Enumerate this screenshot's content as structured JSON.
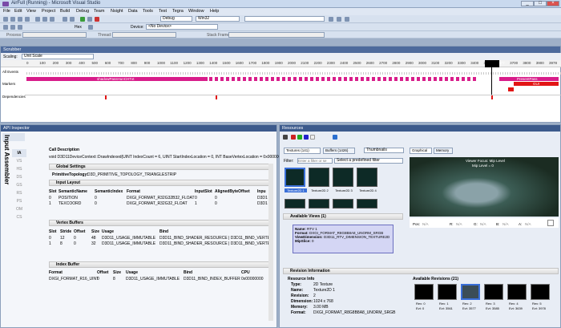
{
  "window": {
    "title": "AirFull (Running) - Microsoft Visual Studio"
  },
  "menu": [
    "File",
    "Edit",
    "View",
    "Project",
    "Build",
    "Debug",
    "Team",
    "Nsight",
    "Data",
    "Tools",
    "Test",
    "Tegra",
    "Window",
    "Help"
  ],
  "toolbar": {
    "config": "Debug",
    "platform": "Win32",
    "hex": "Hex",
    "device_label": "Device:",
    "device_value": "<No Device>",
    "process_label": "Process:",
    "thread_label": "Thread:",
    "stack_label": "Stack Frame:"
  },
  "scrubber": {
    "title": "Scrubber",
    "scaling_label": "Scaling:",
    "scaling_value": "Unit Scale",
    "rows": [
      "All Events",
      "Markers",
      "Dependencies"
    ],
    "ticks": [
      "0",
      "100",
      "200",
      "300",
      "400",
      "500",
      "600",
      "700",
      "800",
      "900",
      "1000",
      "1100",
      "1200",
      "1300",
      "1400",
      "1500",
      "1600",
      "1700",
      "1800",
      "1900",
      "2000",
      "2100",
      "2200",
      "2300",
      "2400",
      "2500",
      "2600",
      "2700",
      "2800",
      "2900",
      "3000",
      "3100",
      "3200",
      "3300",
      "3400",
      "3500",
      "3577",
      "3700",
      "3800",
      "3900",
      "3978"
    ],
    "markers": {
      "shadow": "shadowPassHunCHTxt",
      "present": "PresentPass",
      "gui": "GUI"
    }
  },
  "api": {
    "title": "API Inspector",
    "side_label": "Input Assembler",
    "stages": [
      "IA",
      "VS",
      "HS",
      "DS",
      "GS",
      "RS",
      "PS",
      "OM",
      "CS"
    ],
    "call_desc_label": "Call Description",
    "call_desc": "void D3D11DeviceContext::DrawIndexed(UINT IndexCount = 6, UINT StartIndexLocation = 0, INT BaseVertexLocation = 0x00000000)",
    "global_label": "Global Settings",
    "topology_label": "PrimitiveTopology:",
    "topology": "D3D_PRIMITIVE_TOPOLOGY_TRIANGLESTRIP",
    "layout_label": "Input Layout",
    "layout_headers": [
      "Slot",
      "SemanticName",
      "SemanticIndex",
      "Format",
      "InputSlot",
      "AlignedByteOffset",
      "Inpu"
    ],
    "layout_rows": [
      [
        "0",
        "POSITION",
        "0",
        "DXGI_FORMAT_R32G32B32_FLOAT",
        "0",
        "0",
        "D3D1"
      ],
      [
        "1",
        "TEXCOORD",
        "0",
        "DXGI_FORMAT_R32G32_FLOAT",
        "1",
        "0",
        "D3D1"
      ]
    ],
    "vb_label": "Vertex Buffers",
    "vb_headers": [
      "Slot",
      "Stride",
      "Offset",
      "Size",
      "Usage",
      "Bind"
    ],
    "vb_rows": [
      [
        "0",
        "12",
        "0",
        "48",
        "D3D11_USAGE_IMMUTABLE",
        "D3D11_BIND_SHADER_RESOURCE | D3D11_BIND_VERTE"
      ],
      [
        "1",
        "8",
        "0",
        "32",
        "D3D11_USAGE_IMMUTABLE",
        "D3D11_BIND_SHADER_RESOURCE | D3D11_BIND_VERTE"
      ]
    ],
    "ib_label": "Index Buffer",
    "ib_headers": [
      "Format",
      "Offset",
      "Size",
      "Usage",
      "Bind",
      "CPU"
    ],
    "ib_rows": [
      [
        "DXGI_FORMAT_R16_UINT",
        "0",
        "8",
        "D3D11_USAGE_IMMUTABLE",
        "D3D11_BIND_INDEX_BUFFER",
        "0x00000000"
      ]
    ]
  },
  "resources": {
    "title": "Resources",
    "tab_textures": "Textures (141)",
    "tab_buffers": "Buffers (1426)",
    "view_mode": "Thumbnails",
    "filter_label": "Filter:",
    "filter_placeholder": "Enter a filter or se",
    "predefined": "Select a predefined filter",
    "thumbs": [
      "Texture2D 1",
      "Texture2D 2",
      "Texture2D 3",
      "Texture2D 4"
    ],
    "tab_graphical": "Graphical",
    "tab_memory": "Memory",
    "viewer_focus": "Viewer Focus: Mip Level",
    "mip_level": "Mip Level = 0",
    "pos_label": "Pos:",
    "na": "N/A",
    "r_label": "R:",
    "g_label": "G:",
    "b_label": "B:",
    "a_label": "A:",
    "views_label": "Available Views (1)",
    "view_name_label": "Name:",
    "view_name": "RTV 1",
    "view_format_label": "Format:",
    "view_format": "DXGI_FORMAT_R8G8B8A8_UNORM_SRGB",
    "view_dim_label": "ViewDimension:",
    "view_dim": "D3D11_RTV_DIMENSION_TEXTURE2D",
    "mip_slice_label": "MipSlice:",
    "mip_slice": "0",
    "rev_info_label": "Revision Information",
    "res_info_label": "Resource Info",
    "avail_rev_label": "Available Revisions (21)",
    "info": [
      [
        "Type:",
        "2D Texture"
      ],
      [
        "Name:",
        "Texture2D 1"
      ],
      [
        "Revision:",
        "2"
      ],
      [
        "Dimension:",
        "1024 x 768"
      ],
      [
        "Memory:",
        "3.00 MB"
      ],
      [
        "Format:",
        "DXGI_FORMAT_R8G8B8A8_UNORM_SRGB"
      ]
    ],
    "revs": [
      [
        "Rev: 0",
        "Evt: 0"
      ],
      [
        "Rev: 1",
        "Evt: 3561"
      ],
      [
        "Rev: 2",
        "Evt: 3577"
      ],
      [
        "Rev: 3",
        "Evt: 3585"
      ],
      [
        "Rev: 4",
        "Evt: 3639"
      ],
      [
        "Rev: 5",
        "Evt: 3978"
      ]
    ]
  }
}
